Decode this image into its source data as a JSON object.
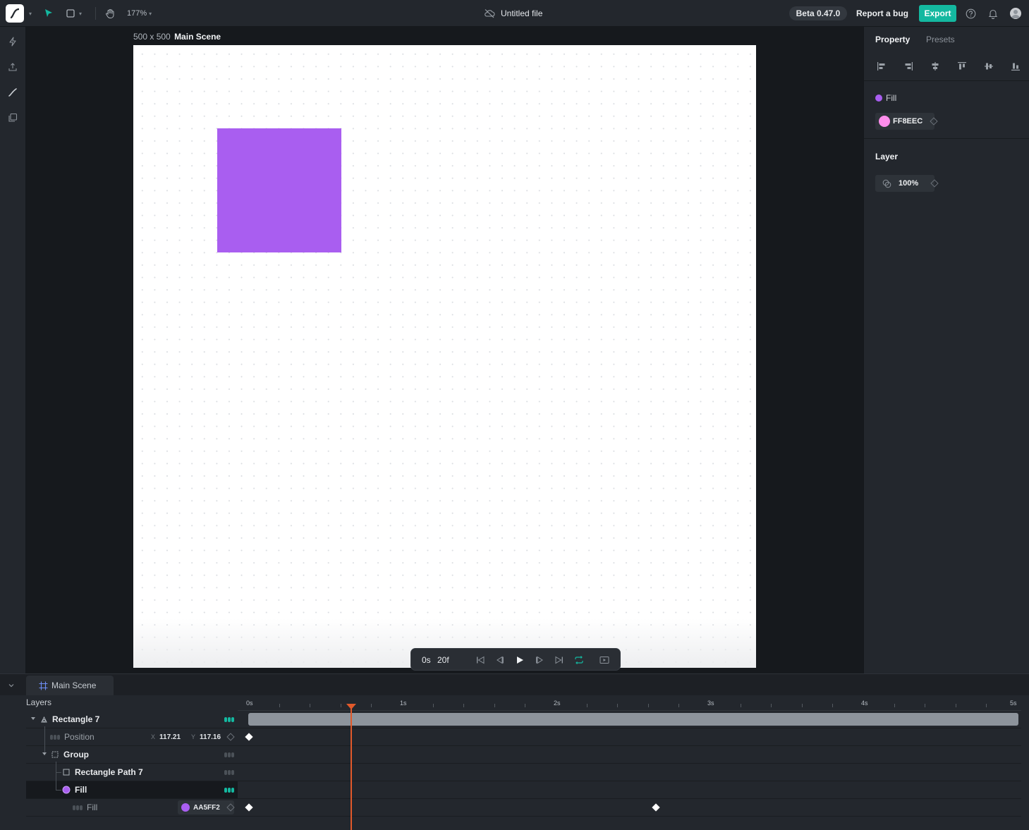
{
  "topbar": {
    "zoom": "177%",
    "file_title": "Untitled file",
    "version": "Beta 0.47.0",
    "report_bug": "Report a bug",
    "export": "Export",
    "icons": [
      "logo-icon",
      "select-tool-icon",
      "rectangle-tool-icon",
      "hand-tool-icon",
      "cloud-off-icon",
      "help-icon",
      "bell-icon",
      "avatar"
    ]
  },
  "left_rail": {
    "icons": [
      "lightning-icon",
      "upload-icon",
      "pen-icon",
      "copy-icon"
    ]
  },
  "canvas": {
    "size_label": "500 x 500",
    "scene_name": "Main Scene",
    "artboard_color": "#ffffff",
    "shape": {
      "name": "Rectangle 7",
      "color": "#a95ef0"
    }
  },
  "playback": {
    "time_seconds": "0s",
    "time_frames": "20f",
    "accent": "#14b8a0",
    "buttons": [
      "skip-to-start",
      "step-back",
      "play",
      "step-forward",
      "skip-to-end",
      "loop",
      "preview"
    ]
  },
  "property_panel": {
    "tabs": [
      "Property",
      "Presets"
    ],
    "fill_label": "Fill",
    "fill_hex": "FF8EEC",
    "fill_color": "#ff8eec",
    "layer_heading": "Layer",
    "opacity": "100%"
  },
  "timeline": {
    "scene_tab": "Main Scene",
    "layers_heading": "Layers",
    "ruler_labels": [
      "0s",
      "1s",
      "2s",
      "3s",
      "4s",
      "5s"
    ],
    "playhead_color": "#e1592a",
    "rows": [
      {
        "name": "Rectangle 7"
      },
      {
        "name": "Position",
        "x_label": "X",
        "x_value": "117.21",
        "y_label": "Y",
        "y_value": "117.16"
      },
      {
        "name": "Group"
      },
      {
        "name": "Rectangle Path 7"
      },
      {
        "name": "Fill"
      },
      {
        "name": "Fill",
        "value": "AA5FF2",
        "color": "#aa5ff2"
      }
    ]
  }
}
